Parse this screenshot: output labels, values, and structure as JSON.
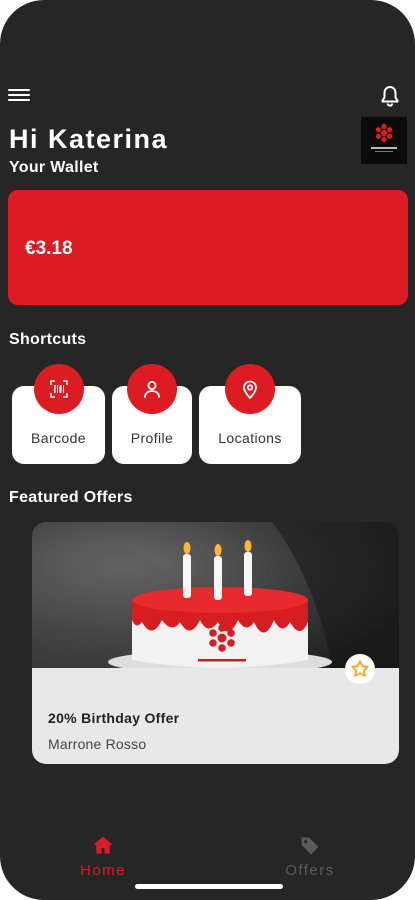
{
  "header": {
    "menu_icon": "hamburger-menu-icon",
    "bell_icon": "bell-icon",
    "greeting": "Hi Katerina"
  },
  "wallet": {
    "label": "Your Wallet",
    "amount": "€3.18"
  },
  "shortcuts": {
    "title": "Shortcuts",
    "items": [
      {
        "label": "Barcode",
        "icon": "barcode-scan-icon"
      },
      {
        "label": "Profile",
        "icon": "person-icon"
      },
      {
        "label": "Locations",
        "icon": "location-pin-icon"
      }
    ]
  },
  "featured": {
    "title": "Featured Offers",
    "offers": [
      {
        "title": "20% Birthday Offer",
        "subtitle": "Marrone Rosso",
        "image": "birthday-cake-image",
        "favorite_icon": "star-icon"
      }
    ]
  },
  "bottom_nav": {
    "items": [
      {
        "label": "Home",
        "icon": "home-icon",
        "active": true
      },
      {
        "label": "Offers",
        "icon": "tag-icon",
        "active": false
      }
    ]
  },
  "colors": {
    "background": "#262626",
    "accent": "#dc1c22",
    "nav_active": "#dc1c22",
    "nav_inactive": "#5a5a5a",
    "card_info_bg": "#e8e8e8",
    "favorite_star": "#f5a623"
  }
}
